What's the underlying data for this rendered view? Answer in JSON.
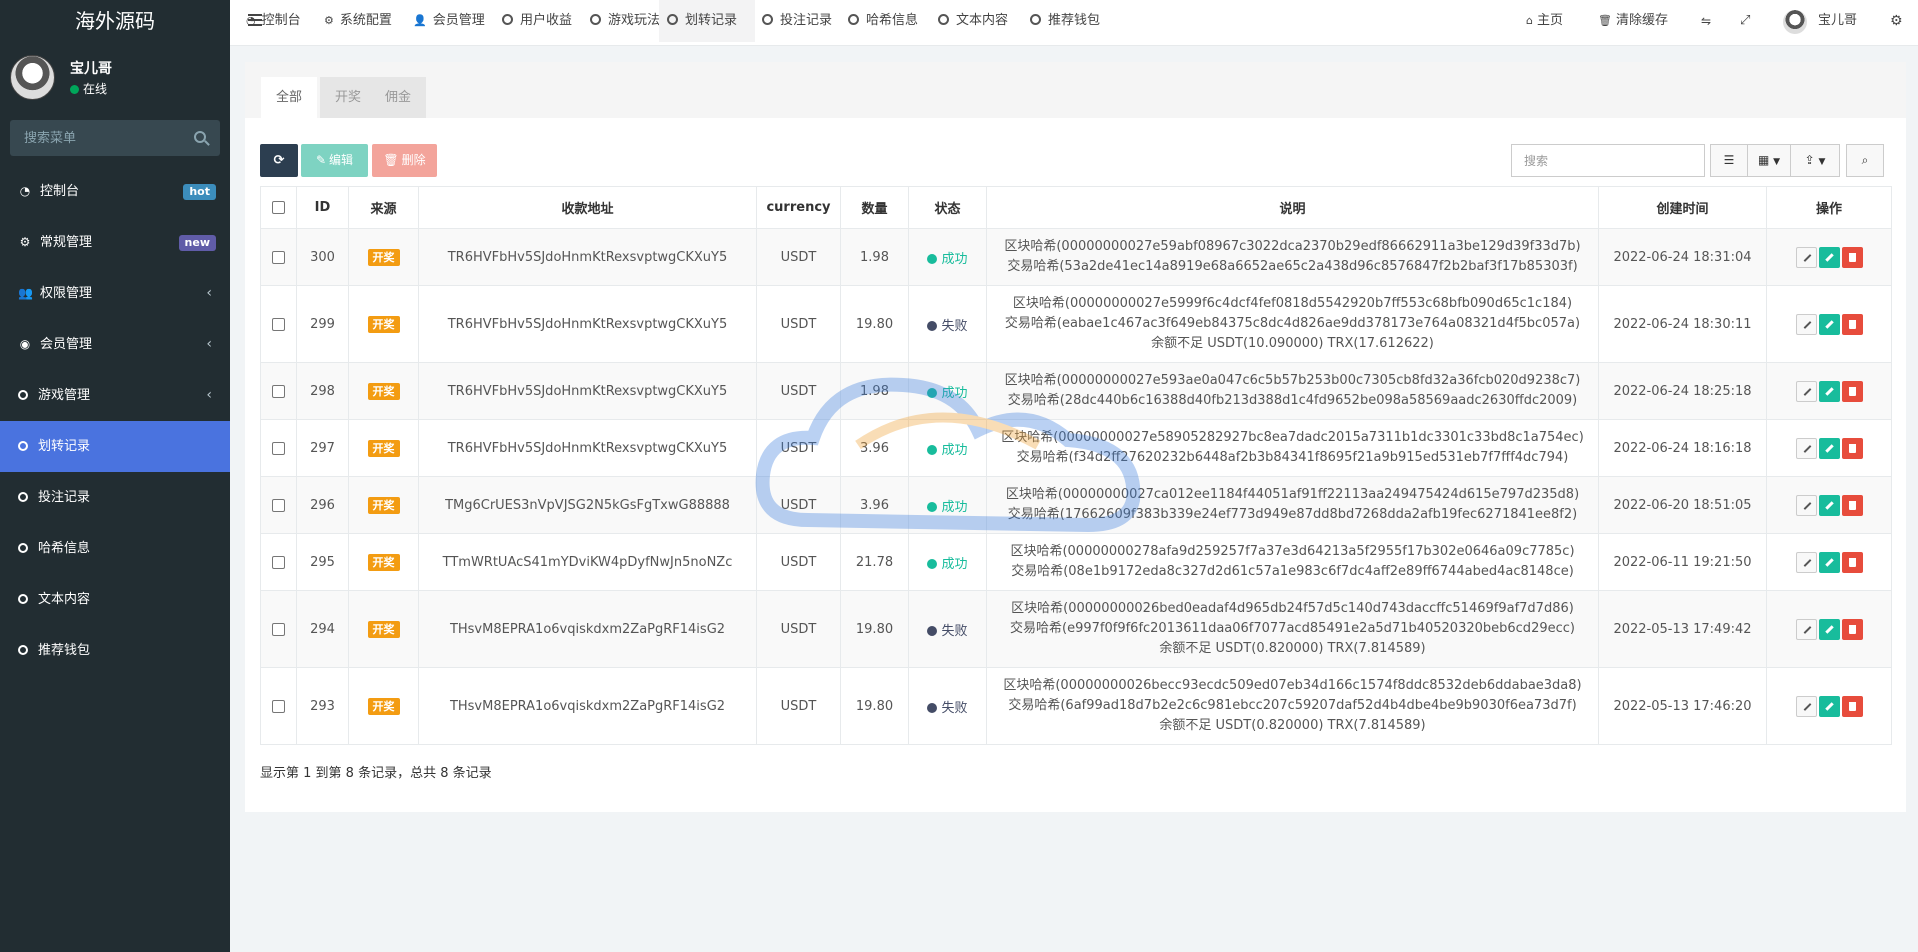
{
  "sidebar": {
    "logo": "海外源码",
    "user": {
      "name": "宝儿哥",
      "status": "在线"
    },
    "search_placeholder": "搜索菜单",
    "items": [
      {
        "label": "控制台",
        "icon": "dashboard-icon",
        "badge": "hot",
        "badge_color": "#3c8dbc"
      },
      {
        "label": "常规管理",
        "icon": "cogs-icon",
        "badge": "new",
        "badge_color": "#605ca8"
      },
      {
        "label": "权限管理",
        "icon": "group-icon",
        "chevron": "‹"
      },
      {
        "label": "会员管理",
        "icon": "user-circle-icon",
        "chevron": "‹"
      },
      {
        "label": "游戏管理",
        "icon": "circle-icon",
        "chevron": "‹"
      },
      {
        "label": "划转记录",
        "icon": "circle-icon",
        "active": true
      },
      {
        "label": "投注记录",
        "icon": "circle-icon"
      },
      {
        "label": "哈希信息",
        "icon": "circle-icon"
      },
      {
        "label": "文本内容",
        "icon": "circle-icon"
      },
      {
        "label": "推荐钱包",
        "icon": "circle-icon"
      }
    ]
  },
  "topnav": {
    "tabs": [
      {
        "label": "控制台",
        "icon": "dashboard-icon"
      },
      {
        "label": "系统配置",
        "icon": "gear-icon"
      },
      {
        "label": "会员管理",
        "icon": "user-icon"
      },
      {
        "label": "用户收益",
        "icon": "circle-icon"
      },
      {
        "label": "游戏玩法",
        "icon": "circle-icon"
      },
      {
        "label": "划转记录",
        "icon": "circle-icon"
      },
      {
        "label": "投注记录",
        "icon": "circle-icon"
      },
      {
        "label": "哈希信息",
        "icon": "circle-icon"
      },
      {
        "label": "文本内容",
        "icon": "circle-icon"
      },
      {
        "label": "推荐钱包",
        "icon": "circle-icon"
      }
    ],
    "home": "主页",
    "clear_cache": "清除缓存",
    "user_name": "宝儿哥"
  },
  "panel": {
    "tabs": [
      "全部",
      "开奖",
      "佣金"
    ],
    "buttons": {
      "refresh": "",
      "edit": "编辑",
      "delete": "删除"
    },
    "search_placeholder": "搜索"
  },
  "table": {
    "headers": [
      "ID",
      "来源",
      "收款地址",
      "currency",
      "数量",
      "状态",
      "说明",
      "创建时间",
      "操作"
    ],
    "rows": [
      {
        "id": "300",
        "source": "开奖",
        "address": "TR6HVFbHv5SJdoHnmKtRexsvptwgCKXuY5",
        "currency": "USDT",
        "amount": "1.98",
        "status": "成功",
        "status_color": "#18bc9c",
        "desc": [
          "区块哈希(00000000027e59abf08967c3022dca2370b29edf86662911a3be129d39f33d7b)",
          "交易哈希(53a2de41ec14a8919e68a6652ae65c2a438d96c8576847f2b2baf3f17b85303f)"
        ],
        "time": "2022-06-24 18:31:04"
      },
      {
        "id": "299",
        "source": "开奖",
        "address": "TR6HVFbHv5SJdoHnmKtRexsvptwgCKXuY5",
        "currency": "USDT",
        "amount": "19.80",
        "status": "失败",
        "status_color": "#444c66",
        "desc": [
          "区块哈希(00000000027e5999f6c4dcf4fef0818d5542920b7ff553c68bfb090d65c1c184)",
          "交易哈希(eabae1c467ac3f649eb84375c8dc4d826ae9dd378173e764a08321d4f5bc057a)",
          "余额不足 USDT(10.090000) TRX(17.612622)"
        ],
        "time": "2022-06-24 18:30:11"
      },
      {
        "id": "298",
        "source": "开奖",
        "address": "TR6HVFbHv5SJdoHnmKtRexsvptwgCKXuY5",
        "currency": "USDT",
        "amount": "1.98",
        "status": "成功",
        "status_color": "#18bc9c",
        "desc": [
          "区块哈希(00000000027e593ae0a047c6c5b57b253b00c7305cb8fd32a36fcb020d9238c7)",
          "交易哈希(28dc440b6c16388d40fb213d388d1c4fd9652be098a58569aadc2630ffdc2009)"
        ],
        "time": "2022-06-24 18:25:18"
      },
      {
        "id": "297",
        "source": "开奖",
        "address": "TR6HVFbHv5SJdoHnmKtRexsvptwgCKXuY5",
        "currency": "USDT",
        "amount": "3.96",
        "status": "成功",
        "status_color": "#18bc9c",
        "desc": [
          "区块哈希(00000000027e58905282927bc8ea7dadc2015a7311b1dc3301c33bd8c1a754ec)",
          "交易哈希(f34d2ff27620232b6448af2b3b84341f8695f21a9b915ed531eb7f7fff4dc794)"
        ],
        "time": "2022-06-24 18:16:18"
      },
      {
        "id": "296",
        "source": "开奖",
        "address": "TMg6CrUES3nVpVJSG2N5kGsFgTxwG88888",
        "currency": "USDT",
        "amount": "3.96",
        "status": "成功",
        "status_color": "#18bc9c",
        "desc": [
          "区块哈希(00000000027ca012ee1184f44051af91ff22113aa249475424d615e797d235d8)",
          "交易哈希(17662609f383b339e24ef773d949e87dd8bd7268dda2afb19fec6271841ee8f2)"
        ],
        "time": "2022-06-20 18:51:05"
      },
      {
        "id": "295",
        "source": "开奖",
        "address": "TTmWRtUAcS41mYDviKW4pDyfNwJn5noNZc",
        "currency": "USDT",
        "amount": "21.78",
        "status": "成功",
        "status_color": "#18bc9c",
        "desc": [
          "区块哈希(00000000278afa9d259257f7a37e3d64213a5f2955f17b302e0646a09c7785c)",
          "交易哈希(08e1b9172eda8c327d2d61c57a1e983c6f7dc4aff2e89ff6744abed4ac8148ce)"
        ],
        "time": "2022-06-11 19:21:50"
      },
      {
        "id": "294",
        "source": "开奖",
        "address": "THsvM8EPRA1o6vqiskdxm2ZaPgRF14isG2",
        "currency": "USDT",
        "amount": "19.80",
        "status": "失败",
        "status_color": "#444c66",
        "desc": [
          "区块哈希(00000000026bed0eadaf4d965db24f57d5c140d743daccffc51469f9af7d7d86)",
          "交易哈希(e997f0f9f6fc2013611daa06f7077acd85491e2a5d71b40520320beb6cd29ecc)",
          "余额不足 USDT(0.820000) TRX(7.814589)"
        ],
        "time": "2022-05-13 17:49:42"
      },
      {
        "id": "293",
        "source": "开奖",
        "address": "THsvM8EPRA1o6vqiskdxm2ZaPgRF14isG2",
        "currency": "USDT",
        "amount": "19.80",
        "status": "失败",
        "status_color": "#444c66",
        "desc": [
          "区块哈希(00000000026becc93ecdc509ed07eb34d166c1574f8ddc8532deb6ddabae3da8)",
          "交易哈希(6af99ad18d7b2e2c6c981ebcc207c59207daf52d4b4dbe4be9b9030f6ea73d7f)",
          "余额不足 USDT(0.820000) TRX(7.814589)"
        ],
        "time": "2022-05-13 17:46:20"
      }
    ],
    "footer": "显示第 1 到第 8 条记录，总共 8 条记录"
  },
  "colors": {
    "sidebar_bg": "#222d32",
    "active_menu": "#4a73df",
    "edit_btn": "#18bc9c",
    "delete_btn": "#e74c3c",
    "refresh_btn": "#2c3e50",
    "source_badge": "#f39c12"
  }
}
